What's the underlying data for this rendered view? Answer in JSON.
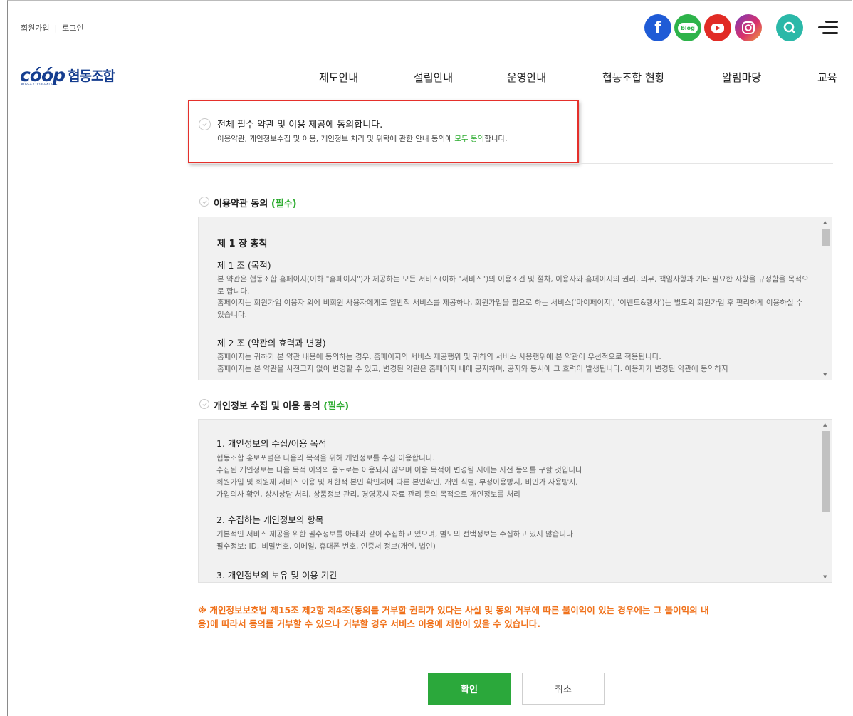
{
  "header": {
    "signup": "회원가입",
    "login": "로그인",
    "social": [
      {
        "name": "facebook-icon",
        "glyph": "f",
        "color": "#1f5bd6"
      },
      {
        "name": "blog-icon",
        "glyph": "blog",
        "color": "#2db34a"
      },
      {
        "name": "youtube-icon",
        "glyph": "▶",
        "color": "#e12b25"
      },
      {
        "name": "instagram-icon",
        "glyph": "◎",
        "color": "#c1357f"
      },
      {
        "name": "search-icon",
        "glyph": "Q",
        "color": "#2bb8a8"
      }
    ]
  },
  "logo": {
    "mark": "cóóp",
    "tagline": "KOREA COOPERATIVES",
    "name": "협동조합"
  },
  "nav": [
    "제도안내",
    "설립안내",
    "운영안내",
    "협동조합 현황",
    "알림마당",
    "교육"
  ],
  "agree_all": {
    "title": "전체 필수 약관 및 이용 제공에 동의합니다.",
    "desc_pre": "이용약관, 개인정보수집 및 이용, 개인정보 처리 및 위탁에 관한 안내 동의에 ",
    "desc_highlight": "모두 동의",
    "desc_post": "합니다."
  },
  "terms": {
    "title": "이용약관 동의 ",
    "required": "(필수)",
    "chapter": "제 1 장 총칙",
    "art1_title": "제 1 조 (목적)",
    "art1_p1": "본 약관은 협동조합 홈페이지(이하 \"홈페이지\")가 제공하는 모든 서비스(이하 \"서비스\")의 이용조건 및 절차, 이용자와 홈페이지의 권리, 의무, 책임사항과 기타 필요한 사항을 규정함을 목적으로 합니다.",
    "art1_p2": "홈페이지는 회원가입 이용자 외에 비회원 사용자에게도 일반적 서비스를 제공하나, 회원가입을 필요로 하는 서비스('마이페이지', '이벤트&행사')는 별도의 회원가입 후 편리하게 이용하실 수 있습니다.",
    "art2_title": "제 2 조 (약관의 효력과 변경)",
    "art2_p1": "홈페이지는 귀하가 본 약관 내용에 동의하는 경우, 홈페이지의 서비스 제공행위 및 귀하의 서비스 사용행위에 본 약관이 우선적으로 적용됩니다.",
    "art2_p2": "홈페이지는 본 약관을 사전고지 없이 변경할 수 있고, 변경된 약관은 홈페이지 내에 공지하며, 공지와 동시에 그 효력이 발생됩니다. 이용자가 변경된 약관에 동의하지"
  },
  "privacy": {
    "title": "개인정보 수집 및 이용 동의 ",
    "required": "(필수)",
    "s1_title": "1. 개인정보의 수집/이용 목적",
    "s1_p1": "협동조합 홍보포털은 다음의 목적을 위해 개인정보를 수집·이용합니다.",
    "s1_p2": "수집된 개인정보는 다음 목적 이외의 용도로는 이용되지 않으며 이용 목적이 변경될 시에는 사전 동의를 구할 것입니다",
    "s1_p3": "회원가입 및 회원제 서비스 이용 및 제한적 본인 확인제에 따른 본인확인, 개인 식별, 부정이용방지, 비인가 사용방지,",
    "s1_p4": "가입의사 확인, 상시상담 처리, 상품정보 관리, 경영공시 자료 관리 등의 목적으로 개인정보를 처리",
    "s2_title": "2. 수집하는 개인정보의 항목",
    "s2_p1": "기본적인 서비스 제공을 위한 필수정보를 아래와 같이 수집하고 있으며, 별도의 선택정보는 수집하고 있지 않습니다",
    "s2_p2": "필수정보: ID, 비밀번호, 이메일, 휴대폰 번호, 인증서 정보(개인, 법인)",
    "s3_title": "3. 개인정보의 보유 및 이용 기간"
  },
  "warning": "※ 개인정보보호법 제15조 제2항 제4조(동의를 거부할 권리가 있다는 사실 및 동의 거부에 따른 불이익이 있는 경우에는 그 불이익의 내용)에 따라서 동의를 거부할 수 있으나 거부할 경우 서비스 이용에 제한이 있을 수 있습니다.",
  "buttons": {
    "ok": "확인",
    "cancel": "취소"
  },
  "colors": {
    "accent_green": "#2ba83b",
    "highlight_red": "#e5302b",
    "warning_orange": "#f0721c",
    "brand_blue": "#153d8f"
  }
}
